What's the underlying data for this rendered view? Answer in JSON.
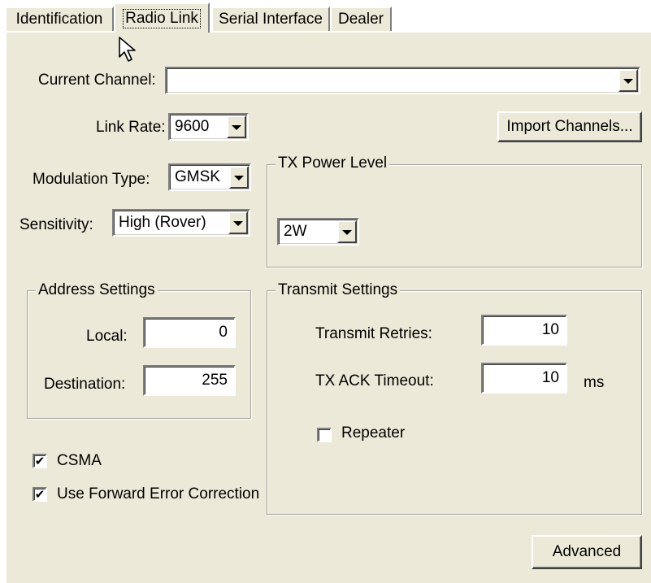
{
  "tabs": [
    {
      "label": "Identification",
      "active": false
    },
    {
      "label": "Radio Link",
      "active": true
    },
    {
      "label": "Serial Interface",
      "active": false
    },
    {
      "label": "Dealer",
      "active": false
    }
  ],
  "current_channel": {
    "label": "Current Channel:",
    "value": ""
  },
  "link_rate": {
    "label": "Link Rate:",
    "value": "9600"
  },
  "import_channels_label": "Import Channels...",
  "modulation": {
    "label": "Modulation Type:",
    "value": "GMSK"
  },
  "sensitivity": {
    "label": "Sensitivity:",
    "value": "High (Rover)"
  },
  "tx_power": {
    "title": "TX Power Level",
    "value": "2W"
  },
  "address_settings": {
    "title": "Address Settings",
    "local_label": "Local:",
    "local_value": "0",
    "destination_label": "Destination:",
    "destination_value": "255"
  },
  "transmit_settings": {
    "title": "Transmit Settings",
    "retries_label": "Transmit Retries:",
    "retries_value": "10",
    "ack_label": "TX ACK Timeout:",
    "ack_value": "10",
    "ack_unit": "ms",
    "repeater_label": "Repeater",
    "repeater_checked": false,
    "repeater_mark": ""
  },
  "csma": {
    "label": "CSMA",
    "checked": true,
    "mark": "✔"
  },
  "fec": {
    "label": "Use Forward Error Correction",
    "checked": true,
    "mark": "✔"
  },
  "advanced_label": "Advanced",
  "colors": {
    "panel": "#ece9d8",
    "field": "#ffffff",
    "shadow": "#808080"
  }
}
